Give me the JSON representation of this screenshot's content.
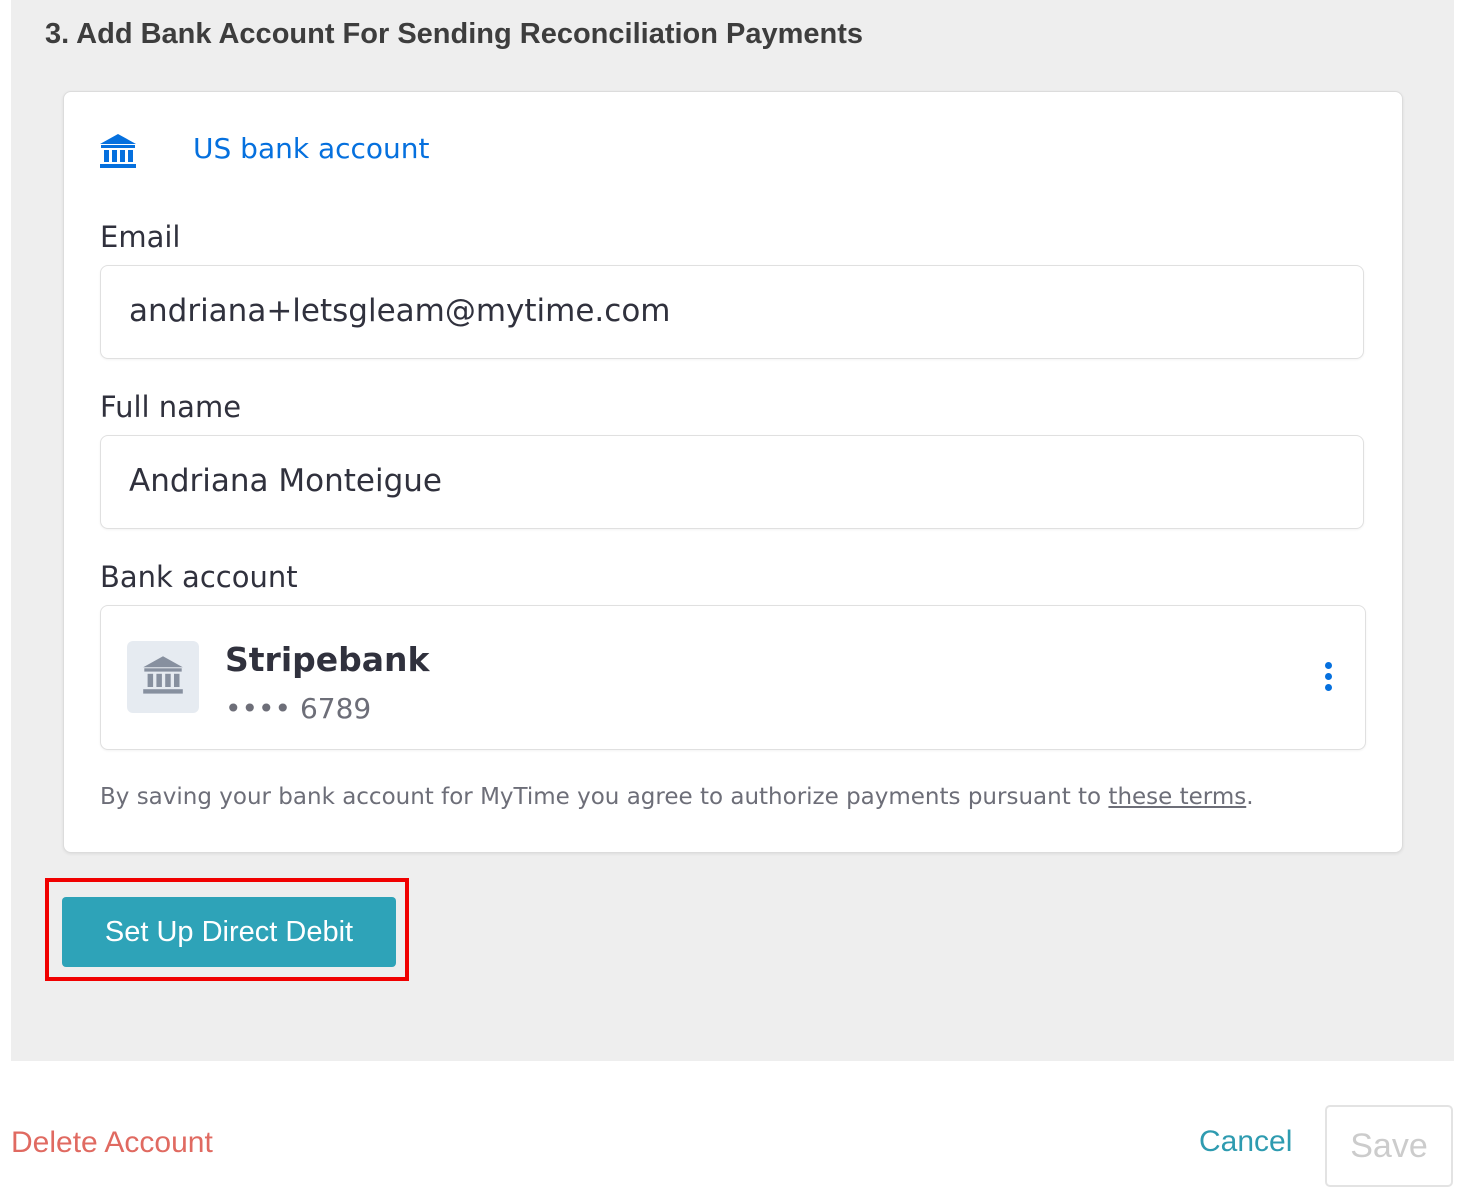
{
  "section": {
    "title": "3. Add Bank Account For Sending Reconciliation Payments"
  },
  "payment_method": {
    "label": "US bank account",
    "icon": "bank-icon",
    "accent_color": "#0570de"
  },
  "form": {
    "email_label": "Email",
    "email_value": "andriana+letsgleam@mytime.com",
    "name_label": "Full name",
    "name_value": "Andriana Monteigue",
    "bank_label": "Bank account"
  },
  "bank_account": {
    "bank_name": "Stripebank",
    "masked_number": "•••• 6789",
    "icon": "bank-icon",
    "menu_icon": "more-vertical-icon"
  },
  "terms": {
    "text": "By saving your bank account for MyTime you agree to authorize payments pursuant to ",
    "link_text": "these terms",
    "suffix": "."
  },
  "actions": {
    "setup_label": "Set Up Direct Debit",
    "setup_color": "#2ea3b8",
    "delete_label": "Delete Account",
    "cancel_label": "Cancel",
    "save_label": "Save"
  }
}
